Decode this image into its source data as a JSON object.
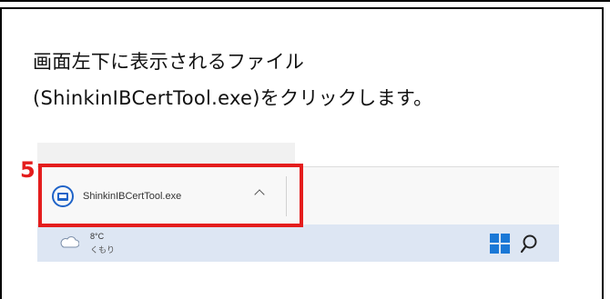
{
  "instruction": {
    "line1": "画面左下に表示されるファイル",
    "line2": "(ShinkinIBCertTool.exe)をクリックします。"
  },
  "step_number": "5",
  "download": {
    "file_name": "ShinkinIBCertTool.exe",
    "file_icon": "application-icon",
    "menu_icon": "chevron-up-icon"
  },
  "taskbar": {
    "weather_temp": "8°C",
    "weather_condition": "くもり",
    "weather_icon": "cloud-icon",
    "start_icon": "windows-start-icon",
    "search_icon": "search-icon"
  },
  "colors": {
    "highlight": "#e41d1d",
    "accent": "#1f63c8"
  }
}
